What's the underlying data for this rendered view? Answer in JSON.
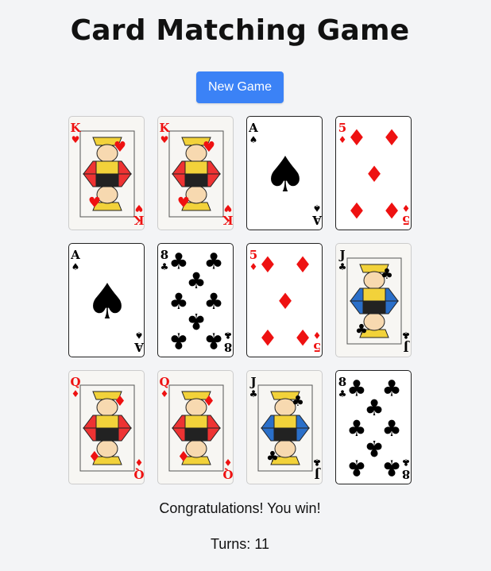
{
  "title": "Card Matching Game",
  "new_game_label": "New Game",
  "status_message": "Congratulations! You win!",
  "turns_label": "Turns:",
  "turns_value": "11",
  "colors": {
    "button": "#3b82f6",
    "red": "#e11",
    "black": "#000"
  },
  "cards": [
    {
      "rank": "K",
      "suit": "hearts",
      "pips": 0
    },
    {
      "rank": "K",
      "suit": "hearts",
      "pips": 0
    },
    {
      "rank": "A",
      "suit": "spades",
      "pips": 1
    },
    {
      "rank": "5",
      "suit": "diamonds",
      "pips": 5
    },
    {
      "rank": "A",
      "suit": "spades",
      "pips": 1
    },
    {
      "rank": "8",
      "suit": "clubs",
      "pips": 8
    },
    {
      "rank": "5",
      "suit": "diamonds",
      "pips": 5
    },
    {
      "rank": "J",
      "suit": "clubs",
      "pips": 0
    },
    {
      "rank": "Q",
      "suit": "diamonds",
      "pips": 0
    },
    {
      "rank": "Q",
      "suit": "diamonds",
      "pips": 0
    },
    {
      "rank": "J",
      "suit": "clubs",
      "pips": 0
    },
    {
      "rank": "8",
      "suit": "clubs",
      "pips": 8
    }
  ]
}
